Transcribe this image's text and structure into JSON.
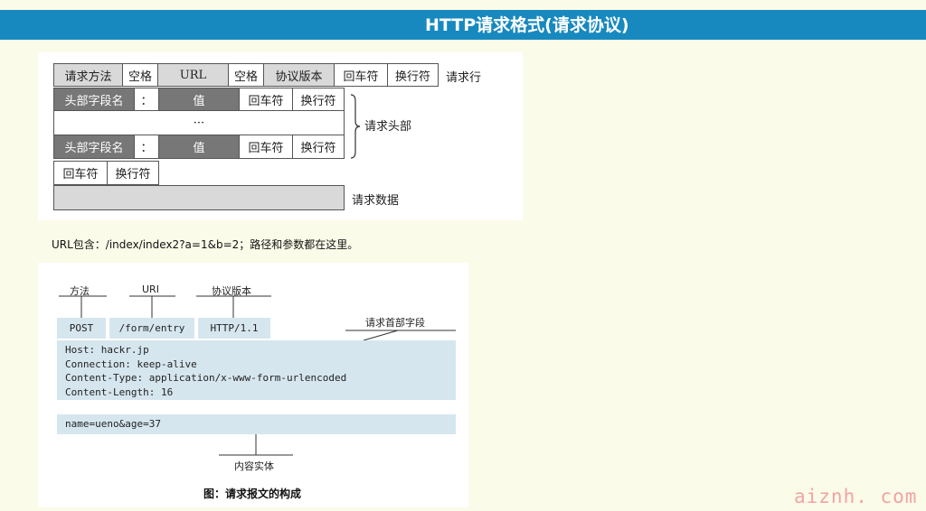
{
  "header": {
    "title": "HTTP请求格式(请求协议)"
  },
  "diagram1": {
    "request_line": {
      "method": "请求方法",
      "space": "空格",
      "url": "URL",
      "version": "协议版本",
      "cr": "回车符",
      "lf": "换行符",
      "label": "请求行"
    },
    "header_row": {
      "name": "头部字段名",
      "colon": "：",
      "value": "值",
      "cr": "回车符",
      "lf": "换行符"
    },
    "ellipsis": "···",
    "headers_label": "请求头部",
    "blank_line": {
      "cr": "回车符",
      "lf": "换行符"
    },
    "data_label": "请求数据"
  },
  "note": "URL包含：/index/index2?a=1&b=2；路径和参数都在这里。",
  "diagram2": {
    "labels": {
      "method": "方法",
      "uri": "URI",
      "version": "协议版本",
      "header_fields": "请求首部字段",
      "body": "内容实体"
    },
    "request_line": {
      "method": "POST",
      "uri": "/form/entry",
      "version": "HTTP/1.1"
    },
    "headers": [
      "Host: hackr.jp",
      "Connection: keep-alive",
      "Content-Type: application/x-www-form-urlencoded",
      "Content-Length: 16"
    ],
    "body": "name=ueno&age=37",
    "caption": "图：请求报文的构成"
  },
  "watermark": "aiznh. com",
  "colors": {
    "header_bar": "#1789bf",
    "background": "#fbfbe9",
    "box_fill": "#d6e6ee"
  }
}
